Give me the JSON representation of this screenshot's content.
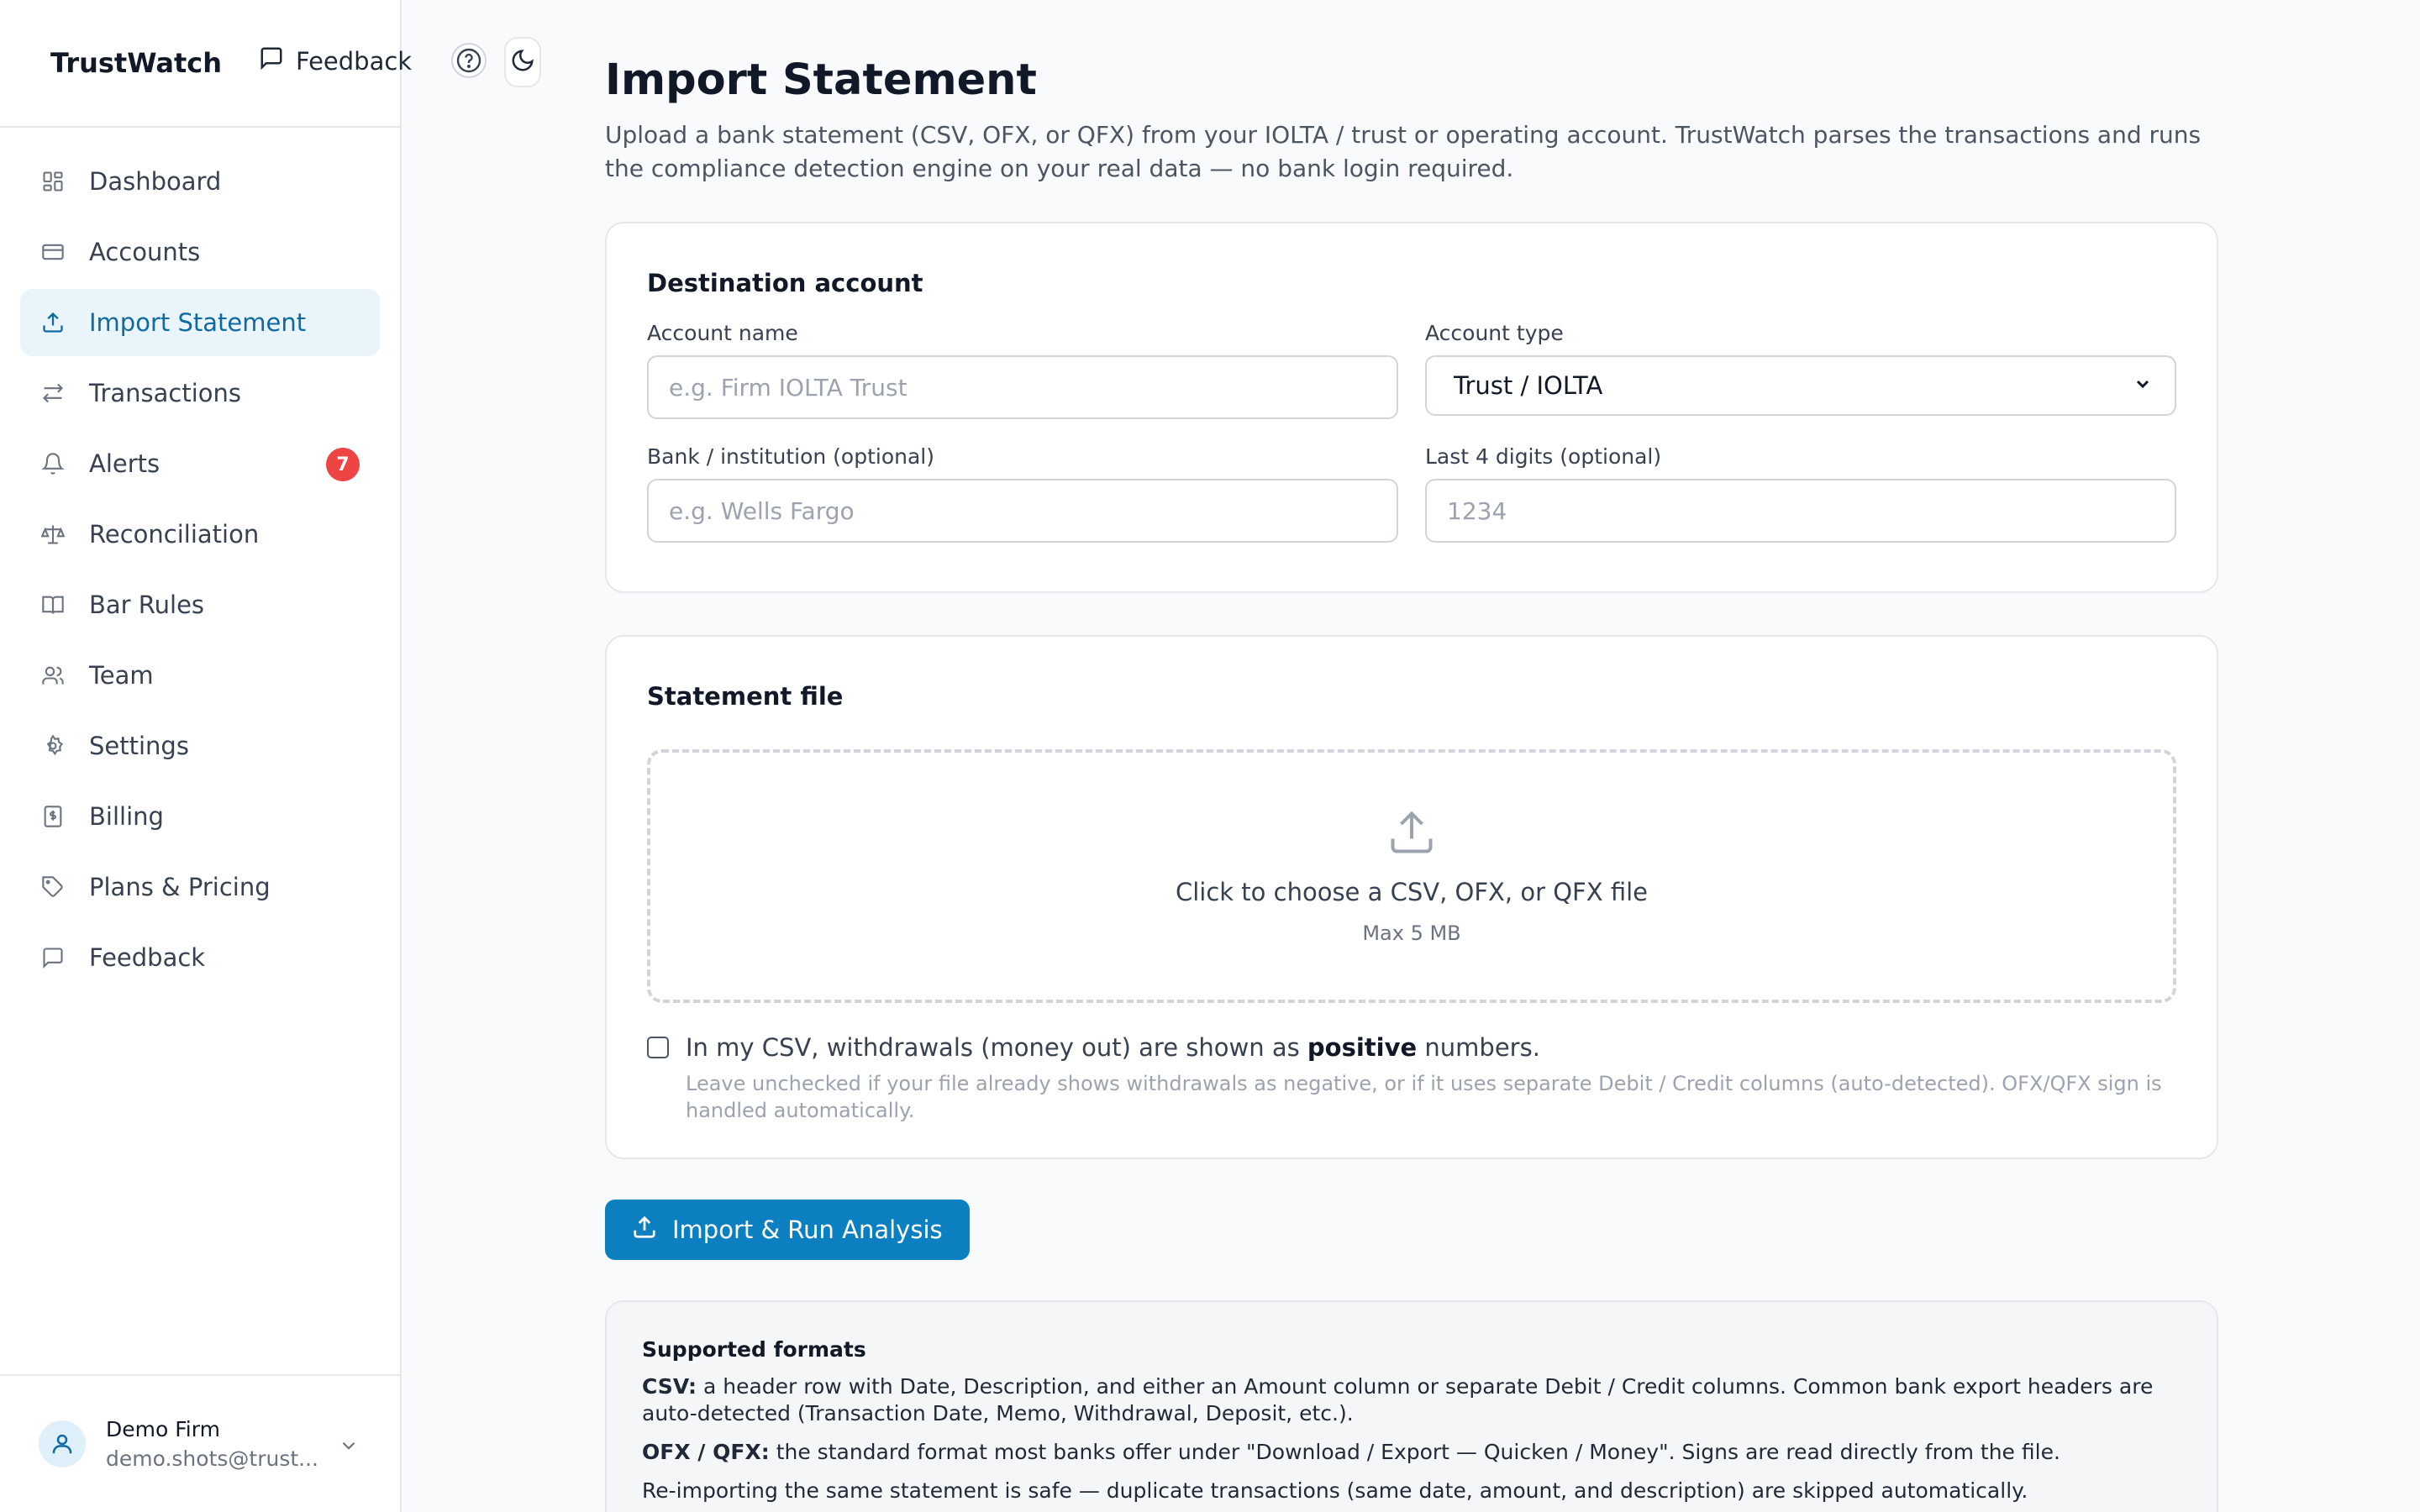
{
  "brand": "TrustWatch",
  "topbar": {
    "feedback_label": "Feedback",
    "help_icon": "help-circle-icon",
    "theme_icon": "moon-icon"
  },
  "sidebar": {
    "items": [
      {
        "label": "Dashboard",
        "icon": "grid-icon"
      },
      {
        "label": "Accounts",
        "icon": "credit-card-icon"
      },
      {
        "label": "Import Statement",
        "icon": "upload-icon",
        "active": true
      },
      {
        "label": "Transactions",
        "icon": "arrows-swap-icon"
      },
      {
        "label": "Alerts",
        "icon": "bell-icon",
        "badge": "7"
      },
      {
        "label": "Reconciliation",
        "icon": "scale-icon"
      },
      {
        "label": "Bar Rules",
        "icon": "book-icon"
      },
      {
        "label": "Team",
        "icon": "users-icon"
      },
      {
        "label": "Settings",
        "icon": "gear-icon"
      },
      {
        "label": "Billing",
        "icon": "receipt-icon"
      },
      {
        "label": "Plans & Pricing",
        "icon": "tag-icon"
      },
      {
        "label": "Feedback",
        "icon": "message-icon"
      }
    ],
    "user": {
      "name": "Demo Firm",
      "email": "demo.shots@trust..."
    }
  },
  "page": {
    "title": "Import Statement",
    "description": "Upload a bank statement (CSV, OFX, or QFX) from your IOLTA / trust or operating account. TrustWatch parses the transactions and runs the compliance detection engine on your real data — no bank login required."
  },
  "destination": {
    "title": "Destination account",
    "account_name_label": "Account name",
    "account_name_placeholder": "e.g. Firm IOLTA Trust",
    "account_type_label": "Account type",
    "account_type_value": "Trust / IOLTA",
    "bank_label": "Bank / institution (optional)",
    "bank_placeholder": "e.g. Wells Fargo",
    "last4_label": "Last 4 digits (optional)",
    "last4_placeholder": "1234"
  },
  "statement": {
    "title": "Statement file",
    "dropzone_text": "Click to choose a CSV, OFX, or QFX file",
    "dropzone_sub": "Max 5 MB",
    "checkbox_checked": false,
    "checkbox_prefix": "In my CSV, withdrawals (money out) are shown as ",
    "checkbox_bold": "positive",
    "checkbox_suffix": " numbers.",
    "checkbox_help": "Leave unchecked if your file already shows withdrawals as negative, or if it uses separate Debit / Credit columns (auto-detected). OFX/QFX sign is handled automatically."
  },
  "import_button": "Import & Run Analysis",
  "formats": {
    "title": "Supported formats",
    "csv_label": "CSV:",
    "csv_text": " a header row with Date, Description, and either an Amount column or separate Debit / Credit columns. Common bank export headers are auto-detected (Transaction Date, Memo, Withdrawal, Deposit, etc.).",
    "ofx_label": "OFX / QFX:",
    "ofx_text": " the standard format most banks offer under \"Download / Export — Quicken / Money\". Signs are read directly from the file.",
    "reimport_text": "Re-importing the same statement is safe — duplicate transactions (same date, amount, and description) are skipped automatically."
  },
  "colors": {
    "accent": "#0b7fc0",
    "active_bg": "#eaf4fb",
    "badge": "#ef4444"
  }
}
